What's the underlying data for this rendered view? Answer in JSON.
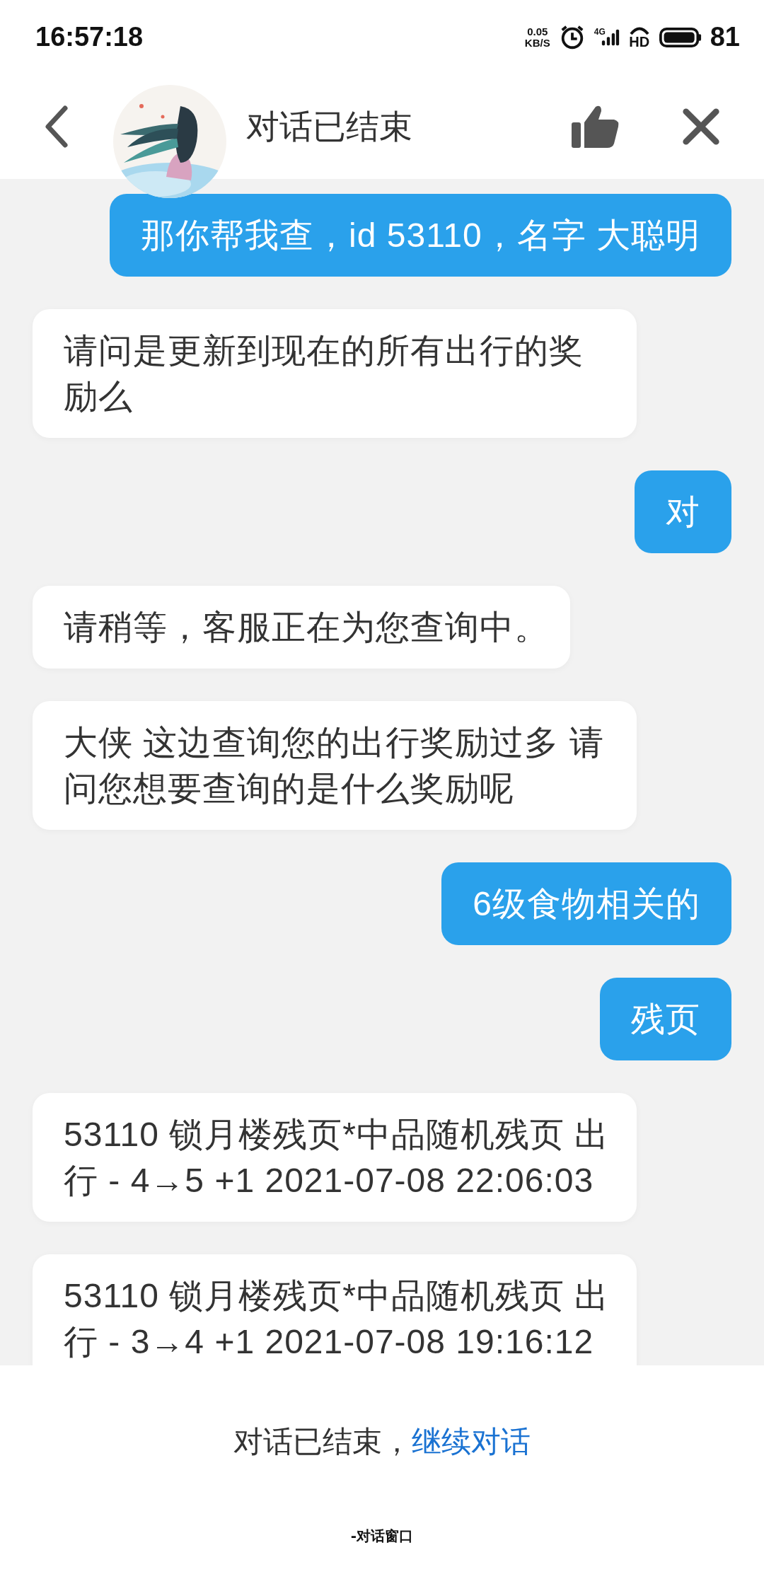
{
  "status_bar": {
    "time": "16:57:18",
    "net_speed": "0.05",
    "net_unit": "KB/S",
    "network": "4G",
    "hd": "HD",
    "battery": "81"
  },
  "header": {
    "title": "对话已结束"
  },
  "messages": [
    {
      "kind": "sent",
      "text": "那你帮我查，id 53110，名字 大聪明"
    },
    {
      "kind": "received",
      "text": "请问是更新到现在的所有出行的奖励么"
    },
    {
      "kind": "sent",
      "text": "对"
    },
    {
      "kind": "received",
      "text": "请稍等，客服正在为您查询中。"
    },
    {
      "kind": "received",
      "text": "大侠 这边查询您的出行奖励过多 请问您想要查询的是什么奖励呢"
    },
    {
      "kind": "sent",
      "text": "6级食物相关的"
    },
    {
      "kind": "sent",
      "text": "残页"
    },
    {
      "kind": "received",
      "text": "53110 锁月楼残页*中品随机残页 出行 - 4→5 +1 2021-07-08 22:06:03"
    },
    {
      "kind": "received",
      "text": "53110 锁月楼残页*中品随机残页 出行 - 3→4 +1 2021-07-08 19:16:12"
    }
  ],
  "footer": {
    "text": "对话已结束，",
    "link": "继续对话"
  },
  "caption": "-对话窗口"
}
